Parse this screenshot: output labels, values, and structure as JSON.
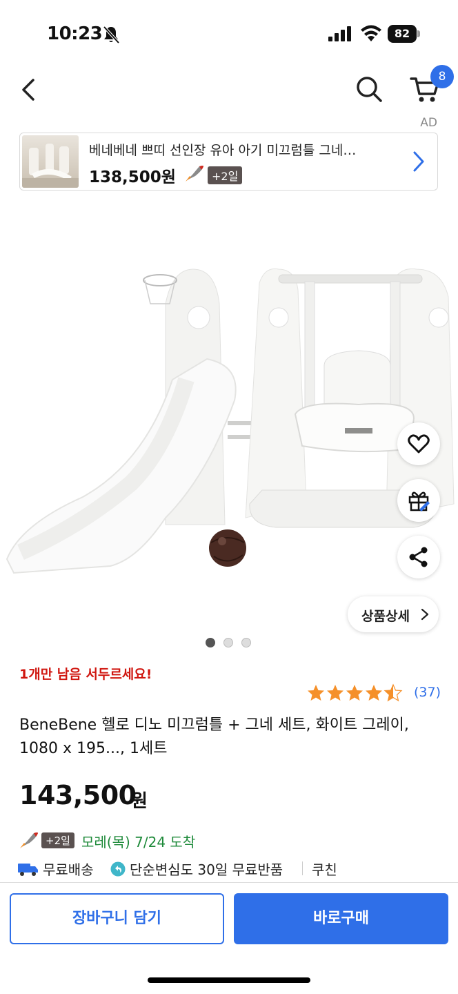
{
  "status_bar": {
    "time": "10:23",
    "battery": "82",
    "icons": [
      "bell-off-icon",
      "signal-icon",
      "wifi-icon",
      "battery-icon"
    ]
  },
  "nav": {
    "icons": [
      "back-icon",
      "search-icon",
      "cart-icon"
    ],
    "cart_count": "8"
  },
  "ad": {
    "label": "AD",
    "title": "베네베네 쁘띠 선인장 유아 아기 미끄럼틀 그네…",
    "price": "138,500원",
    "badge": "+2일"
  },
  "hero": {
    "actions": [
      "heart-icon",
      "gift-icon",
      "share-icon"
    ],
    "detail_label": "상품상세",
    "carousel_count": 3,
    "carousel_active": 1
  },
  "product": {
    "stock_notice": "1개만 남음 서두르세요!",
    "rating": 4.5,
    "review_count": "(37)",
    "title": "BeneBene 헬로 디노 미끄럼틀 + 그네 세트, 화이트 그레이, 1080 x 195..., 1세트",
    "price": "143,500",
    "price_unit": "원"
  },
  "delivery": {
    "badge": "+2일",
    "arrival": "모레(목) 7/24 도착"
  },
  "benefits": {
    "free_shipping": "무료배송",
    "return_policy": "단순변심도 30일 무료반품",
    "coupon": "쿠친"
  },
  "actions": {
    "add_to_cart": "장바구니 담기",
    "buy_now": "바로구매"
  },
  "colors": {
    "accent": "#2f6fe8",
    "stock_red": "#d0160f",
    "delivery_green": "#1e8a3a",
    "star": "#f5902a"
  }
}
